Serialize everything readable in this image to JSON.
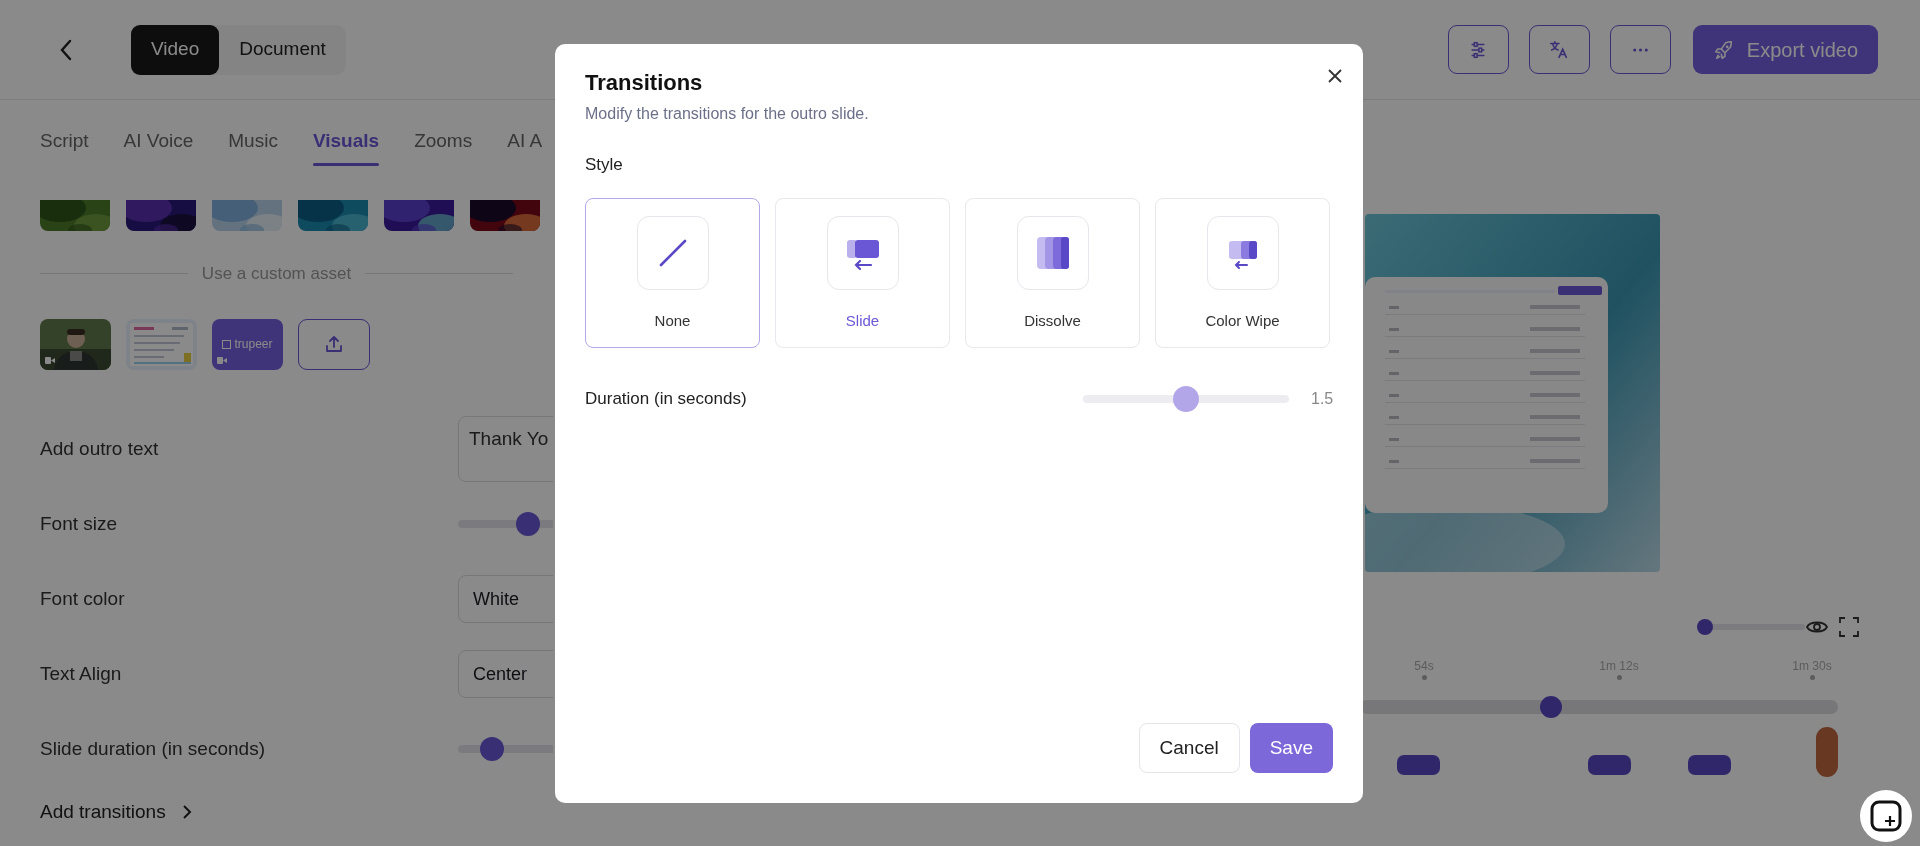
{
  "header": {
    "modes": [
      {
        "label": "Video",
        "selected": true
      },
      {
        "label": "Document",
        "selected": false
      }
    ],
    "export_button": "Export video"
  },
  "tabs": [
    {
      "label": "Script",
      "selected": false
    },
    {
      "label": "AI Voice",
      "selected": false
    },
    {
      "label": "Music",
      "selected": false
    },
    {
      "label": "Visuals",
      "selected": true
    },
    {
      "label": "Zooms",
      "selected": false
    },
    {
      "label": "AI A",
      "selected": false
    }
  ],
  "custom_asset_label": "Use a custom asset",
  "custom_assets": [
    {
      "kind": "picture"
    },
    {
      "kind": "picture"
    },
    {
      "kind": "logo",
      "text": "trupeer"
    },
    {
      "kind": "upload"
    }
  ],
  "form": [
    {
      "kind": "text",
      "label": "Add outro text",
      "value": "Thank Yo"
    },
    {
      "kind": "slider",
      "label": "Font size",
      "level": 0.35
    },
    {
      "kind": "select",
      "label": "Font color",
      "value": "White"
    },
    {
      "kind": "select",
      "label": "Text Align",
      "value": "Center"
    },
    {
      "kind": "slider",
      "label": "Slide duration (in seconds)",
      "level": 0.17
    }
  ],
  "add_transitions": "Add transitions",
  "zoom_slider": {
    "level": 0
  },
  "timeline": {
    "ticks": [
      "54s",
      "1m 12s",
      "1m 30s"
    ],
    "scrubber": {
      "level": 0.4
    }
  },
  "modal": {
    "title": "Transitions",
    "subtitle": "Modify the transitions for the outro slide.",
    "style_label": "Style",
    "styles": [
      {
        "label": "None",
        "kind": "none",
        "selected": true,
        "hovered": false
      },
      {
        "label": "Slide",
        "kind": "slide",
        "selected": false,
        "hovered": true
      },
      {
        "label": "Dissolve",
        "kind": "dissolve",
        "selected": false,
        "hovered": false
      },
      {
        "label": "Color Wipe",
        "kind": "wipe",
        "selected": false,
        "hovered": false
      }
    ],
    "duration": {
      "label": "Duration (in seconds)",
      "level": 0.5,
      "reading": "1.5"
    },
    "buttons": [
      {
        "label": "Cancel",
        "kind": "secondary"
      },
      {
        "label": "Save",
        "kind": "primary"
      }
    ]
  }
}
